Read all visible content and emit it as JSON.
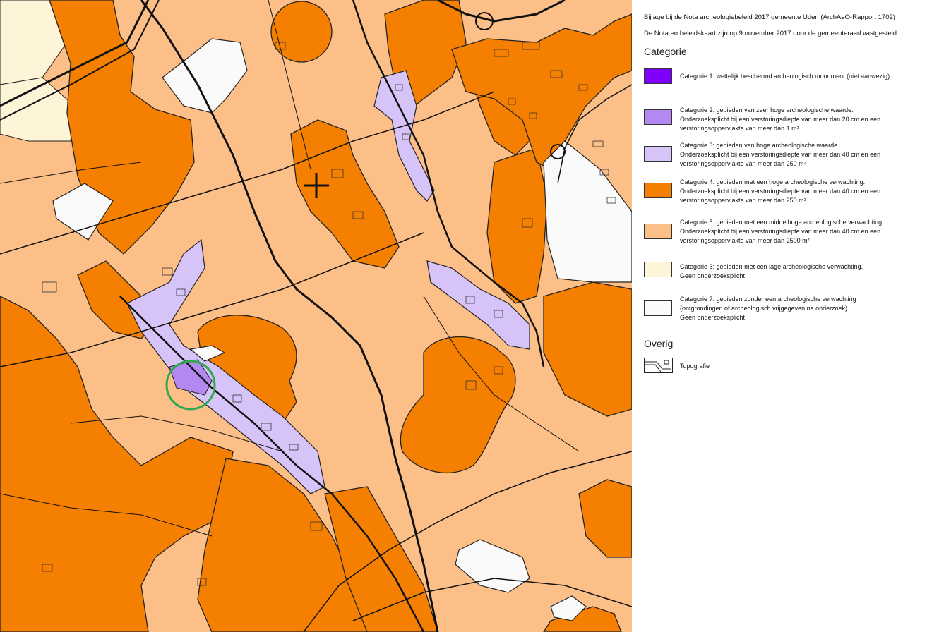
{
  "legend": {
    "intro_line1": "Bijlage bij de Nota archeologiebeleid 2017 gemeente Uden (ArchAeO-Rapport 1702)",
    "intro_line2": "De Nota en beleidskaart zijn op 9 november 2017 door de gemeenteraad vastgesteld.",
    "categorie_heading": "Categorie",
    "overig_heading": "Overig",
    "categories": [
      {
        "color": "#7f00ff",
        "lines": [
          "Categorie 1: wettelijk beschermd archeologisch monument (niet aanwezig)"
        ]
      },
      {
        "color": "#b388f0",
        "lines": [
          "Categorie 2: gebieden van zeer hoge archeologische waarde.",
          "Onderzoeksplicht bij een verstoringsdiepte van meer dan 20 cm en een",
          "verstoringsoppervlakte van meer dan 1 m²"
        ]
      },
      {
        "color": "#d6c3f7",
        "lines": [
          "Categorie 3: gebieden van hoge archeologische waarde.",
          "Onderzoeksplicht bij een verstoringsdiepte van meer dan 40 cm en een",
          "verstoringsoppervlakte van meer dan 250 m²"
        ]
      },
      {
        "color": "#f57f00",
        "lines": [
          "Categorie 4: gebieden met een hoge archeologische verwachting.",
          "Onderzoeksplicht bij een verstoringsdiepte van meer dan 40 cm en een",
          "verstoringsoppervlakte van meer dan 250 m²"
        ]
      },
      {
        "color": "#fcbf88",
        "lines": [
          "Categorie 5: gebieden met een middelhoge archeologische verwachting.",
          "Onderzoeksplicht bij een verstoringsdiepte van meer dan 40 cm en een",
          "verstoringsoppervlakte van meer dan 2500 m²"
        ]
      },
      {
        "color": "#fef4d8",
        "lines": [
          "Categorie 6: gebieden met een lage archeologische verwachting.",
          "Geen onderzoeksplicht"
        ]
      },
      {
        "color": "#fafafa",
        "lines": [
          "Categorie 7: gebieden zonder een archeologische verwachting",
          "(ontgrondingen of archeologisch vrijgegeven na onderzoek)",
          "Geen onderzoeksplicht"
        ]
      }
    ],
    "overig": [
      {
        "icon": "topografie-symbol",
        "label": "Topografie"
      }
    ]
  }
}
